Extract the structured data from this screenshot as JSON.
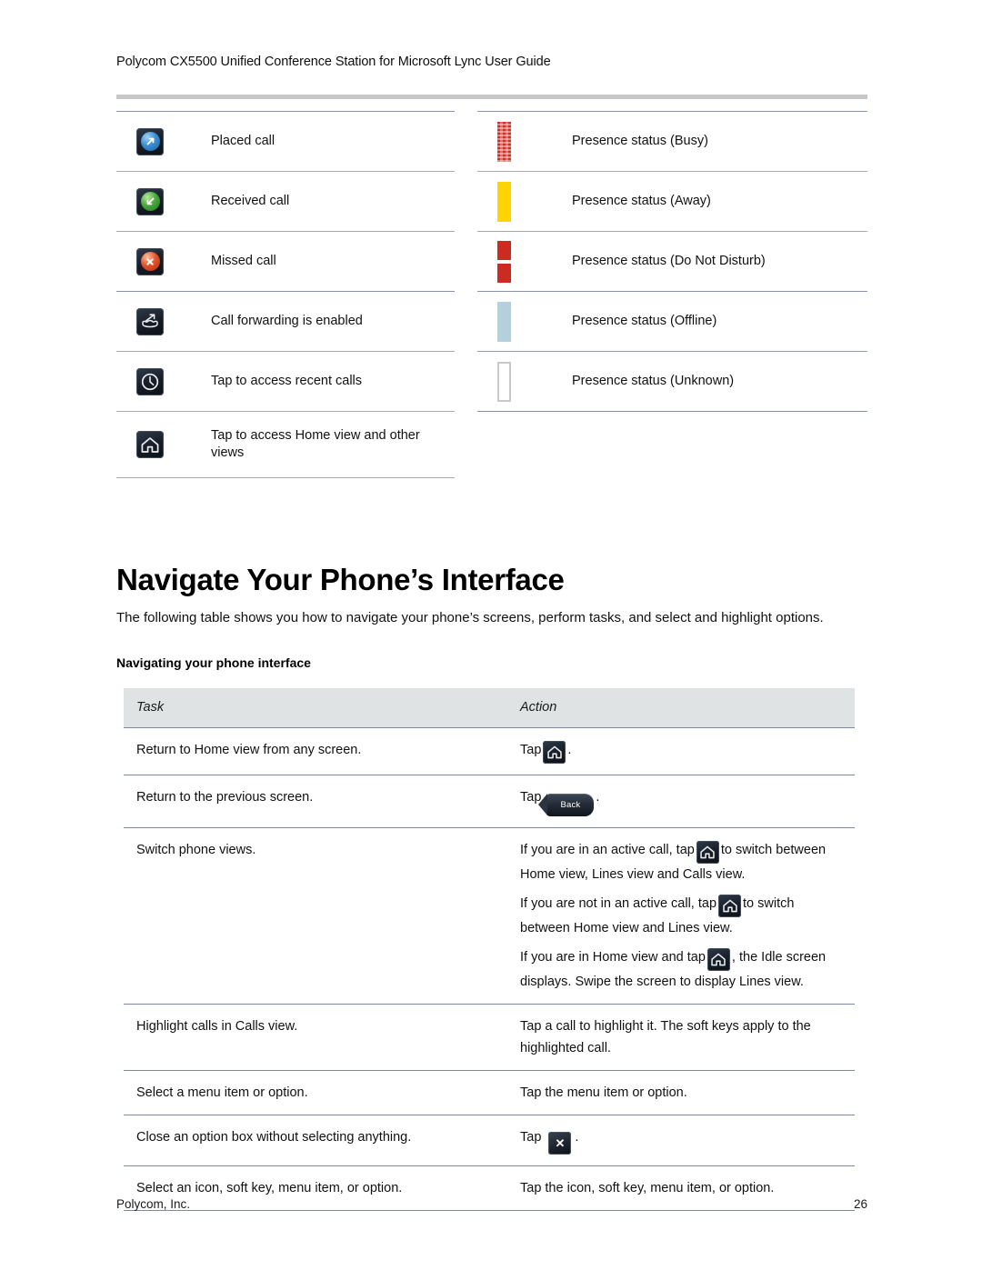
{
  "header": {
    "title": "Polycom CX5500 Unified Conference Station for Microsoft Lync User Guide"
  },
  "icon_legend": {
    "left_rows": [
      {
        "icon": "placed-call-icon",
        "label": "Placed call"
      },
      {
        "icon": "received-call-icon",
        "label": "Received call"
      },
      {
        "icon": "missed-call-icon",
        "label": "Missed call"
      },
      {
        "icon": "call-forwarding-icon",
        "label": "Call forwarding is enabled"
      },
      {
        "icon": "recent-calls-clock-icon",
        "label": "Tap to access recent calls"
      },
      {
        "icon": "home-icon",
        "label": "Tap to access Home view and other views"
      }
    ],
    "right_rows": [
      {
        "icon": "presence-busy-bar",
        "label": "Presence status (Busy)"
      },
      {
        "icon": "presence-away-bar",
        "label": "Presence status (Away)"
      },
      {
        "icon": "presence-dnd-bar",
        "label": "Presence status (Do Not Disturb)"
      },
      {
        "icon": "presence-offline-bar",
        "label": "Presence status (Offline)"
      },
      {
        "icon": "presence-unknown-bar",
        "label": "Presence status (Unknown)"
      }
    ]
  },
  "section": {
    "heading": "Navigate Your Phone’s Interface",
    "intro": "The following table shows you how to navigate your phone’s screens, perform tasks, and select and highlight options.",
    "table_caption": "Navigating your phone interface"
  },
  "nav_table": {
    "columns": [
      "Task",
      "Action"
    ],
    "rows": [
      {
        "task": "Return to Home view from any screen.",
        "action_prefix": "Tap",
        "action_icon": "home-icon",
        "action_suffix": "."
      },
      {
        "task": "Return to the previous screen.",
        "action_prefix": "Tap",
        "action_icon": "back-key",
        "action_icon_label": "Back",
        "action_suffix": "."
      },
      {
        "task": "Switch phone views.",
        "paragraphs": [
          {
            "before": "If you are in an active call, tap",
            "icon": "home-icon",
            "after": "to switch between Home view, Lines view and Calls view."
          },
          {
            "before": "If you are not in an active call, tap",
            "icon": "home-icon",
            "after": "to switch between Home view and Lines view."
          },
          {
            "before": "If you are in Home view and tap",
            "icon": "home-icon",
            "after": ", the Idle screen displays. Swipe the screen to display Lines view."
          }
        ]
      },
      {
        "task": "Highlight calls in Calls view.",
        "action": "Tap a call to highlight it. The soft keys apply to the highlighted call."
      },
      {
        "task": "Select a menu item or option.",
        "action": "Tap the menu item or option."
      },
      {
        "task": "Close an option box without selecting anything.",
        "action_prefix": "Tap",
        "action_icon": "close-x-key",
        "action_suffix": "."
      },
      {
        "task": "Select an icon, soft key, menu item, or option.",
        "action": "Tap the icon, soft key, menu item, or option."
      }
    ]
  },
  "footer": {
    "company": "Polycom, Inc.",
    "page_number": "26"
  },
  "colors": {
    "header_rule": "#c7c7c7",
    "table_border": "#7f8aa0",
    "table_header_bg": "#dfe3e4",
    "presence_busy": "#e8382c",
    "presence_away": "#ffd400",
    "presence_dnd": "#cd2a22",
    "presence_offline": "#b4d0dd",
    "presence_unknown": "#ffffff"
  }
}
